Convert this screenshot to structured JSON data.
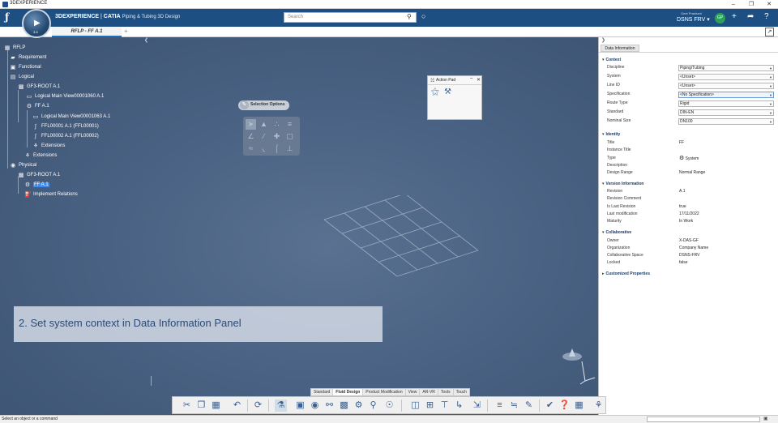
{
  "window": {
    "title": "3DEXPERIENCE"
  },
  "header": {
    "brand_prefix": "3DEXPERIENCE",
    "brand_app": "CATIA",
    "app_name": "Piping & Tubing 3D Design",
    "search_placeholder": "Search",
    "user_name": "Geet Prashant",
    "collab_space": "DSNS FRV",
    "avatar_initials": "GP",
    "compass_version": "3.8"
  },
  "tabs": {
    "active": "RFLP - FF A.1",
    "add": "+"
  },
  "tree": {
    "root": "RFLP",
    "requirement": "Requirement",
    "functional": "Functional",
    "logical": "Logical",
    "gf3_root_logical": "GF3-ROOT A.1",
    "logical_view_1": "Logical Main View00001060 A.1",
    "ff_logical": "FF A.1",
    "logical_view_2": "Logical Main View00001063 A.1",
    "ffl1": "FFL00001 A.1 (FFL00001)",
    "ffl2": "FFL00002 A.1 (FFL00002)",
    "extensions_1": "Extensions",
    "extensions_2": "Extensions",
    "physical": "Physical",
    "gf3_root_physical": "GF3-ROOT A.1",
    "ff_physical": "FF A.1",
    "implement_relations": "Implement Relations"
  },
  "selection_options": {
    "title": "Selection Options"
  },
  "action_pad": {
    "title": "Action Pad"
  },
  "instruction": "2. Set system context in Data Information Panel",
  "panel": {
    "tab": "Data Information",
    "context": {
      "title": "Context",
      "discipline_label": "Discipline",
      "discipline_value": "Piping/Tubing",
      "system_label": "System",
      "system_value": "<Unset>",
      "line_id_label": "Line ID",
      "line_id_value": "<Unset>",
      "specification_label": "Specification",
      "specification_value": "<No Specification>",
      "route_type_label": "Route Type",
      "route_type_value": "Rigid",
      "standard_label": "Standard",
      "standard_value": "DIN-EN",
      "nominal_size_label": "Nominal Size",
      "nominal_size_value": "DN100"
    },
    "identity": {
      "title": "Identity",
      "title_label": "Title",
      "title_value": "FF",
      "instance_title_label": "Instance Title",
      "type_label": "Type",
      "type_value": "System",
      "description_label": "Description",
      "design_range_label": "Design Range",
      "design_range_value": "Normal Range"
    },
    "version": {
      "title": "Version Information",
      "revision_label": "Revision",
      "revision_value": "A.1",
      "revision_comment_label": "Revision Comment",
      "is_last_revision_label": "Is Last Revision",
      "is_last_revision_value": "true",
      "last_modification_label": "Last modification",
      "last_modification_value": "17/11/2022",
      "maturity_label": "Maturity",
      "maturity_value": "In Work"
    },
    "collaborative": {
      "title": "Collaborative",
      "owner_label": "Owner",
      "owner_value": "X-DAS-GF",
      "organization_label": "Organization",
      "organization_value": "Company Name",
      "collab_space_label": "Collaborative Space",
      "collab_space_value": "DSNS-FRV",
      "locked_label": "Locked",
      "locked_value": "false"
    },
    "customized": {
      "title": "Customized Properties"
    }
  },
  "toolbar_tabs": [
    "Standard",
    "Fluid Design",
    "Product Modification",
    "View",
    "AR-VR",
    "Tools",
    "Touch"
  ],
  "status": {
    "text": "Select an object or a command"
  }
}
